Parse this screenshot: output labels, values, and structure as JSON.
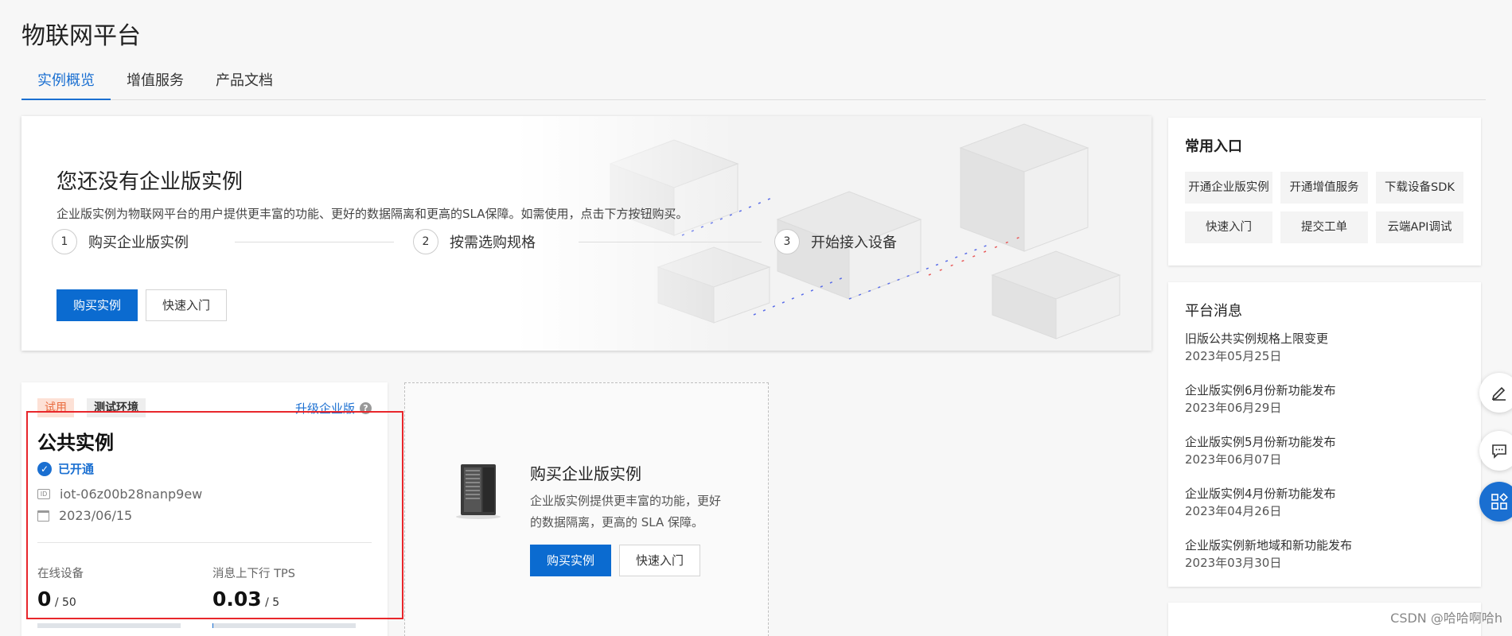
{
  "page": {
    "title": "物联网平台"
  },
  "tabs": [
    {
      "label": "实例概览",
      "active": true
    },
    {
      "label": "增值服务",
      "active": false
    },
    {
      "label": "产品文档",
      "active": false
    }
  ],
  "hero": {
    "title": "您还没有企业版实例",
    "description": "企业版实例为物联网平台的用户提供更丰富的功能、更好的数据隔离和更高的SLA保障。如需使用，点击下方按钮购买。",
    "steps": [
      {
        "num": "1",
        "label": "购买企业版实例"
      },
      {
        "num": "2",
        "label": "按需选购规格"
      },
      {
        "num": "3",
        "label": "开始接入设备"
      }
    ],
    "primary_button": "购买实例",
    "secondary_button": "快速入门"
  },
  "quick_access": {
    "title": "常用入口",
    "items": [
      "开通企业版实例",
      "开通增值服务",
      "下载设备SDK",
      "快速入门",
      "提交工单",
      "云端API调试"
    ]
  },
  "news": {
    "title": "平台消息",
    "items": [
      {
        "title": "旧版公共实例规格上限变更",
        "date": "2023年05月25日"
      },
      {
        "title": "企业版实例6月份新功能发布",
        "date": "2023年06月29日"
      },
      {
        "title": "企业版实例5月份新功能发布",
        "date": "2023年06月07日"
      },
      {
        "title": "企业版实例4月份新功能发布",
        "date": "2023年04月26日"
      },
      {
        "title": "企业版实例新地域和新功能发布",
        "date": "2023年03月30日"
      }
    ]
  },
  "instance": {
    "badge_trial": "试用",
    "badge_env": "测试环境",
    "upgrade_link": "升级企业版",
    "help_symbol": "?",
    "id_symbol": "ID",
    "check_symbol": "✓",
    "title": "公共实例",
    "status": "已开通",
    "id": "iot-06z00b28nanp9ew",
    "date": "2023/06/15",
    "stats": [
      {
        "label": "在线设备",
        "value": "0",
        "limit": " / 50",
        "fraction": 0.0
      },
      {
        "label": "消息上下行 TPS",
        "value": "0.03",
        "limit": " / 5",
        "fraction": 0.006
      }
    ]
  },
  "buy_card": {
    "title": "购买企业版实例",
    "description": "企业版实例提供更丰富的功能，更好的数据隔离，更高的 SLA 保障。",
    "primary_button": "购买实例",
    "secondary_button": "快速入门"
  },
  "float_tools": [
    {
      "icon": "edit-icon",
      "active": false
    },
    {
      "icon": "chat-icon",
      "active": false
    },
    {
      "icon": "apps-icon",
      "active": true
    }
  ],
  "watermark": "CSDN @哈哈啊哈h",
  "colors": {
    "accent": "#1a6fd1",
    "primary_button": "#0b6bd0",
    "trial_badge": "#e96a3c",
    "highlight": "#e8262b"
  }
}
